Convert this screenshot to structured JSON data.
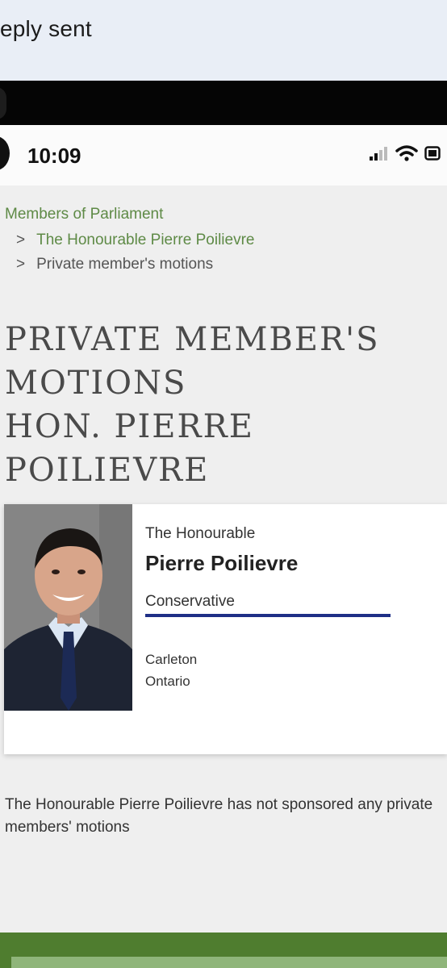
{
  "reply": {
    "text": "eply sent"
  },
  "status_bar": {
    "time": "10:09",
    "icons": [
      "signal-icon",
      "wifi-icon",
      "battery-icon"
    ]
  },
  "breadcrumb": {
    "root": "Members of Parliament",
    "items": [
      {
        "label": "The Honourable Pierre Poilievre",
        "type": "link"
      },
      {
        "label": "Private member's motions",
        "type": "current"
      }
    ]
  },
  "page": {
    "title_lines": [
      "PRIVATE MEMBER'S",
      "MOTIONS",
      "HON. PIERRE",
      "POILIEVRE"
    ]
  },
  "member_card": {
    "honorific": "The Honourable",
    "name": "Pierre Poilievre",
    "party": "Conservative",
    "party_color": "#1f2f86",
    "riding": "Carleton",
    "province": "Ontario"
  },
  "notice": "The Honourable Pierre Poilievre has not sponsored any private members' motions",
  "colors": {
    "link_green": "#5e8a46",
    "footer_green": "#4f7d2f"
  }
}
